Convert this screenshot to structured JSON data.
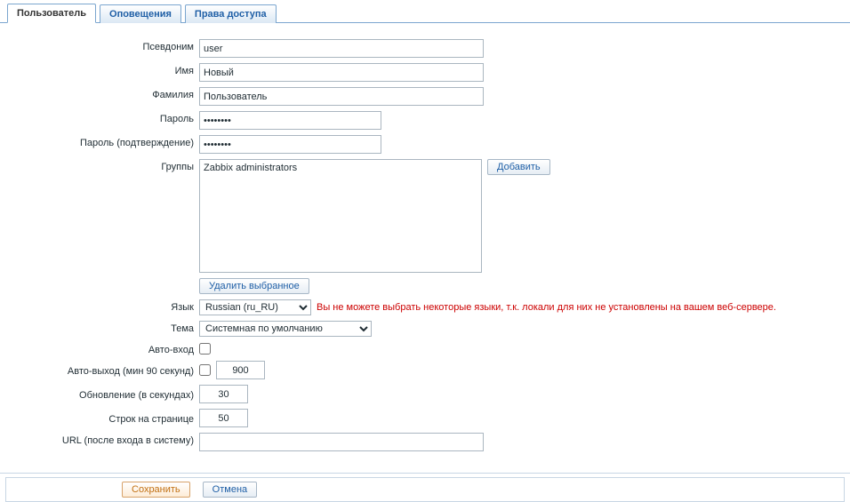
{
  "tabs": [
    {
      "id": "user",
      "label": "Пользователь",
      "active": true
    },
    {
      "id": "media",
      "label": "Оповещения",
      "active": false
    },
    {
      "id": "perm",
      "label": "Права доступа",
      "active": false
    }
  ],
  "labels": {
    "alias": "Псевдоним",
    "name": "Имя",
    "surname": "Фамилия",
    "password": "Пароль",
    "password_confirm": "Пароль (подтверждение)",
    "groups": "Группы",
    "language": "Язык",
    "theme": "Тема",
    "auto_login": "Авто-вход",
    "auto_logout": "Авто-выход (мин 90 секунд)",
    "refresh": "Обновление (в секундах)",
    "rows": "Строк на странице",
    "url": "URL (после входа в систему)"
  },
  "values": {
    "alias": "user",
    "name": "Новый",
    "surname": "Пользователь",
    "password": "••••••••",
    "password_confirm": "••••••••",
    "auto_logout": "900",
    "refresh": "30",
    "rows": "50",
    "url": ""
  },
  "groups": {
    "items": [
      "Zabbix administrators"
    ],
    "add_button": "Добавить",
    "delete_button": "Удалить выбранное"
  },
  "language": {
    "selected": "Russian (ru_RU)",
    "warning": "Вы не можете выбрать некоторые языки, т.к. локали для них не установлены на вашем веб-сервере."
  },
  "theme": {
    "selected": "Системная по умолчанию"
  },
  "buttons": {
    "save": "Сохранить",
    "cancel": "Отмена"
  }
}
